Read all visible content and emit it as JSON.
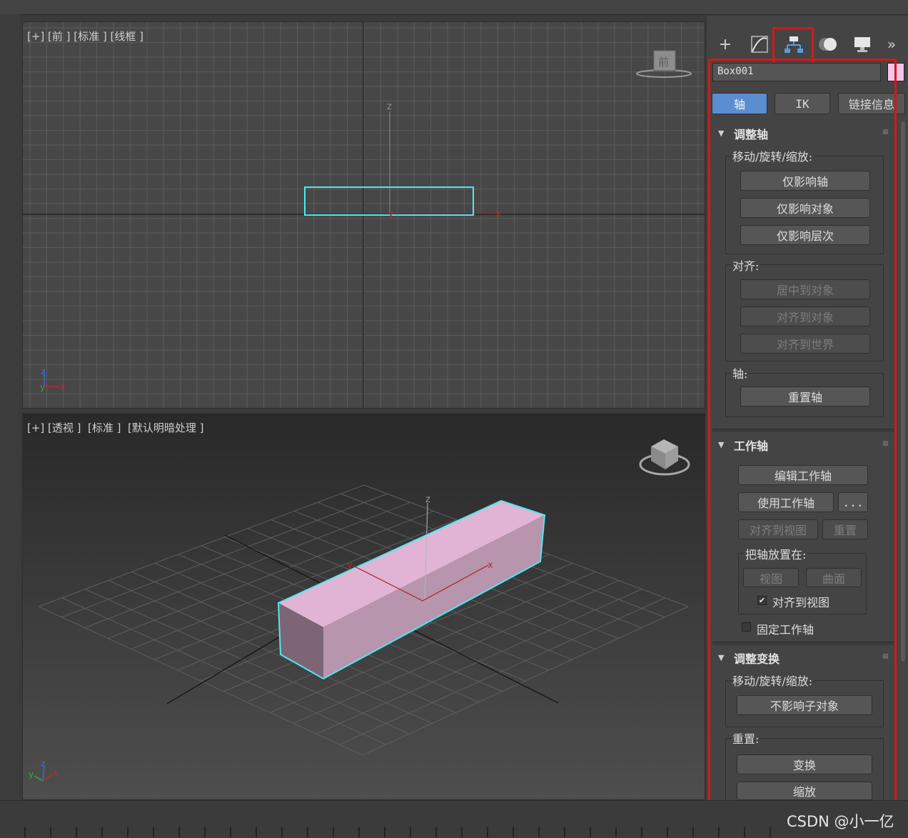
{
  "viewports": {
    "front": {
      "label": "[+] [前 ] [标准 ] [线框 ]",
      "cube_label": "前"
    },
    "perspective": {
      "label": "[+] [透视 ]  [标准 ]  [默认明暗处理 ]"
    }
  },
  "axis_labels": {
    "x": "x",
    "y": "y",
    "z": "z"
  },
  "command_tabs": [
    {
      "name": "create",
      "glyph": "+"
    },
    {
      "name": "modify",
      "glyph": ""
    },
    {
      "name": "hierarchy",
      "glyph": ""
    },
    {
      "name": "motion",
      "glyph": ""
    },
    {
      "name": "display",
      "glyph": ""
    },
    {
      "name": "more",
      "glyph": "»"
    }
  ],
  "object_name": "Box001",
  "object_color": "#f6c4ea",
  "hierarchy_tabs": [
    "轴",
    "IK",
    "链接信息"
  ],
  "adjust_pivot": {
    "title": "调整轴",
    "move_group": "移动/旋转/缩放:",
    "buttons": [
      "仅影响轴",
      "仅影响对象",
      "仅影响层次"
    ],
    "align_group": "对齐:",
    "align_buttons": [
      "居中到对象",
      "对齐到对象",
      "对齐到世界"
    ],
    "pivot_group": "轴:",
    "reset_button": "重置轴"
  },
  "working_pivot": {
    "title": "工作轴",
    "edit": "编辑工作轴",
    "use": "使用工作轴",
    "more": "...",
    "align_view": "对齐到视图",
    "reset": "重置",
    "place_group": "把轴放置在:",
    "view": "视图",
    "surface": "曲面",
    "align_to_view_check": "对齐到视图",
    "fixed": "固定工作轴"
  },
  "adjust_transform": {
    "title": "调整变换",
    "move_group": "移动/旋转/缩放:",
    "no_affect_children": "不影响子对象",
    "reset_group": "重置:",
    "transform": "变换",
    "scale": "缩放"
  },
  "watermark": "CSDN @小一亿",
  "colors": {
    "highlight": "#d11a1a",
    "selection": "#4ee8f0",
    "active_tab": "#5b8dd1",
    "box": "#e0b2d4"
  }
}
